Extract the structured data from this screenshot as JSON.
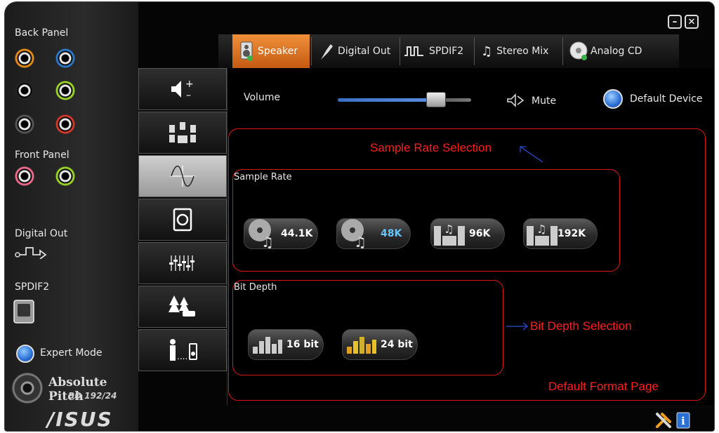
{
  "left_panel": {
    "back_panel_label": "Back Panel",
    "front_panel_label": "Front Panel",
    "digital_out_label": "Digital Out",
    "spdif2_label": "SPDIF2",
    "expert_mode_label": "Expert Mode",
    "logo_title": "Absolute Pitch",
    "logo_subtitle": "BD 192/24",
    "brand": "/ISUS"
  },
  "tabs": [
    {
      "label": "Speaker",
      "icon": "speaker-icon",
      "active": true
    },
    {
      "label": "Digital Out",
      "icon": "plug-icon",
      "active": false
    },
    {
      "label": "SPDIF2",
      "icon": "pulse-wave-icon",
      "active": false
    },
    {
      "label": "Stereo Mix",
      "icon": "music-note-icon",
      "active": false
    },
    {
      "label": "Analog CD",
      "icon": "cd-icon",
      "active": false
    }
  ],
  "side_tabs": [
    {
      "icon": "volume-plus-minus-icon",
      "active": false
    },
    {
      "icon": "speaker-config-icon",
      "active": false
    },
    {
      "icon": "waveform-icon",
      "active": true
    },
    {
      "icon": "subwoofer-icon",
      "active": false
    },
    {
      "icon": "equalizer-icon",
      "active": false
    },
    {
      "icon": "environment-icon",
      "active": false
    },
    {
      "icon": "room-correction-icon",
      "active": false
    }
  ],
  "main": {
    "volume_label": "Volume",
    "volume_level": 0.72,
    "mute_label": "Mute",
    "default_device_label": "Default Device",
    "sample_rate_label": "Sample Rate",
    "bit_depth_label": "Bit Depth",
    "sample_rates": [
      {
        "label": "44.1K",
        "selected": false
      },
      {
        "label": "48K",
        "selected": true
      },
      {
        "label": "96K",
        "selected": false
      },
      {
        "label": "192K",
        "selected": false
      }
    ],
    "bit_depths": [
      {
        "label": "16 bit",
        "selected": false
      },
      {
        "label": "24 bit",
        "selected": true
      }
    ]
  },
  "annotations": {
    "sample_rate_selection": "Sample Rate Selection",
    "bit_depth_selection": "Bit Depth Selection",
    "default_format_page": "Default Format Page"
  },
  "colors": {
    "accent_orange": "#e0782a",
    "annotation_red": "#e01616",
    "annotation_blue": "#2a4fd6",
    "selected_text": "#66c7ff"
  }
}
